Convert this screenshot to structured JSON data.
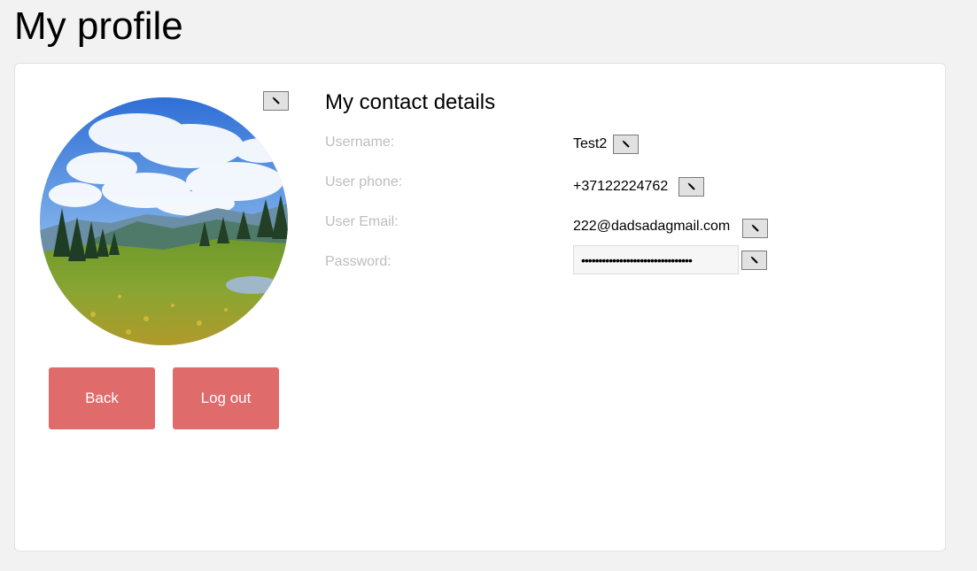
{
  "page": {
    "title": "My profile"
  },
  "profile": {
    "avatar_alt": "Mountain meadow landscape",
    "back_label": "Back",
    "logout_label": "Log out"
  },
  "contact": {
    "title": "My contact details",
    "fields": [
      {
        "label": "Username:",
        "value": "Test2"
      },
      {
        "label": "User phone:",
        "value": "+37122224762"
      },
      {
        "label": "User Email:",
        "value": "222@dadsadagmail.com"
      },
      {
        "label": "Password:",
        "value": "********************************"
      }
    ]
  },
  "colors": {
    "page_background": "#f2f2f2",
    "card_background": "#ffffff",
    "action_button": "#e06b6b",
    "label_text": "#bdbdbd",
    "edit_button": "#e1e1e1"
  },
  "icons": {
    "edit": "pencil-icon"
  }
}
